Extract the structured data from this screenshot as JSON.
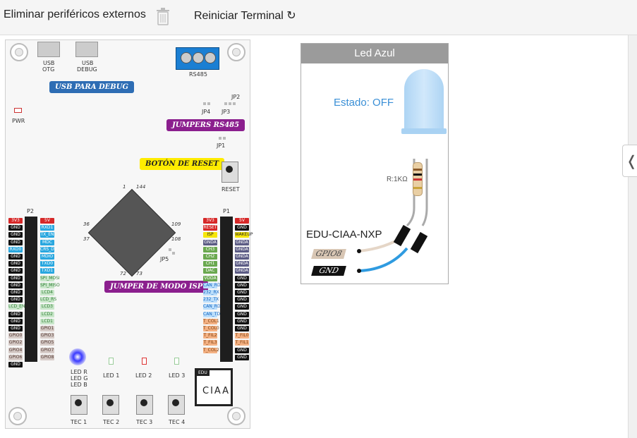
{
  "toolbar": {
    "remove_peripherals_label": "Eliminar periféricos externos",
    "restart_terminal_label": "Reiniciar Terminal ↻"
  },
  "board": {
    "usb_otg": "USB\nOTG",
    "usb_otg_l1": "USB",
    "usb_otg_l2": "OTG",
    "usb_debug_l1": "USB",
    "usb_debug_l2": "DEBUG",
    "rs485": "RS485",
    "pwr": "PWR",
    "jp2": "JP2",
    "jp4": "JP4",
    "jp3": "JP3",
    "jp1": "JP1",
    "jp5": "JP5",
    "reset": "RESET",
    "p2": "P2",
    "p1": "P1",
    "chip_pin_1": "1",
    "chip_pin_144": "144",
    "chip_pin_36": "36",
    "chip_pin_37": "37",
    "chip_pin_109": "109",
    "chip_pin_108": "108",
    "chip_pin_72": "72",
    "chip_pin_73": "73",
    "callout_usb": "USB PARA DEBUG",
    "callout_jumpers": "JUMPERS RS485",
    "callout_reset": "BOTÓN DE RESET",
    "callout_isp": "JUMPER DE MODO ISP",
    "led_rgb_r": "LED R",
    "led_rgb_g": "LED G",
    "led_rgb_b": "LED B",
    "led1": "LED 1",
    "led2": "LED 2",
    "led3": "LED 3",
    "tec1": "TEC 1",
    "tec2": "TEC 2",
    "tec3": "TEC 3",
    "tec4": "TEC 4",
    "logo_edu": "EDU",
    "logo_ciaa": "CIAA",
    "p2_left": [
      "3V3",
      "GND",
      "GND",
      "GND",
      "RXD0",
      "GND",
      "GND",
      "GND",
      "GND",
      "GND",
      "GND",
      "GND",
      "LCD_EN",
      "GND",
      "GND",
      "GND",
      "GPIO0",
      "GPIO2",
      "GPIO4",
      "GPIO6",
      "GND"
    ],
    "p2_right": [
      "5V",
      "RXD1",
      "TX_EN",
      "MDC",
      "CRS_DV",
      "MDIO",
      "TXD0",
      "TXD1",
      "SPI_MOSI",
      "SPI_MISO",
      "LCD4",
      "LCD_RS",
      "LCD3",
      "LCD2",
      "LCD1",
      "GPIO1",
      "GPIO3",
      "GPIO5",
      "GPIO7",
      "GPIO8"
    ],
    "p1_left": [
      "3V3",
      "RESET",
      "ISP",
      "GNDA",
      "CH3",
      "CH2",
      "CH1",
      "DAC",
      "VDDA",
      "CAN_RD",
      "232_RX",
      "232_TX",
      "CAN_RD",
      "CAN_TD",
      "T_COL1",
      "T_COL0",
      "T_FIL2",
      "T_FIL3",
      "T_COL2"
    ],
    "p1_right": [
      "5V",
      "GND",
      "WAKEUP",
      "GNDA",
      "GNDA",
      "GNDA",
      "GNDA",
      "GNDA",
      "GND",
      "GND",
      "GND",
      "GND",
      "GND",
      "GND",
      "GND",
      "GND",
      "T_FIL0",
      "T_FIL1",
      "GND",
      "GND"
    ]
  },
  "panel": {
    "title": "Led Azul",
    "state": "Estado: OFF",
    "resistor": "R:1KΩ",
    "board_name": "EDU-CIAA-NXP",
    "gpio_tag": "GPIO8",
    "gnd_tag": "GND"
  },
  "colors": {
    "callout_usb": "#2e6db4",
    "callout_purple": "#8b1f8e",
    "callout_yellow": "#ffec00",
    "rs485_terminal": "#1b7fd3",
    "state_text": "#3a8fd6"
  }
}
